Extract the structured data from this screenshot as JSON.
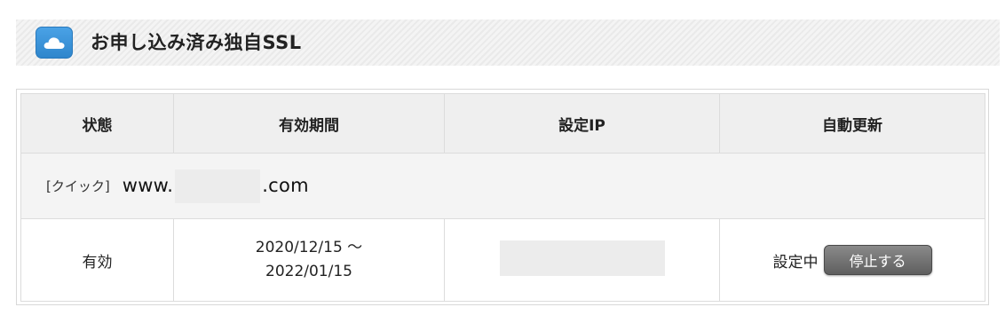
{
  "section": {
    "title": "お申し込み済み独自SSL",
    "icon": "cloud-icon",
    "icon_color": "#3d95dc"
  },
  "table": {
    "headers": [
      "状態",
      "有効期間",
      "設定IP",
      "自動更新"
    ],
    "domain_row": {
      "tag": "[クイック]",
      "domain_prefix": "www.",
      "domain_suffix": ".com"
    },
    "data_row": {
      "status": "有効",
      "period_start": "2020/12/15 〜",
      "period_end": "2022/01/15",
      "auto_renew_status": "設定中",
      "stop_button_label": "停止する"
    }
  }
}
